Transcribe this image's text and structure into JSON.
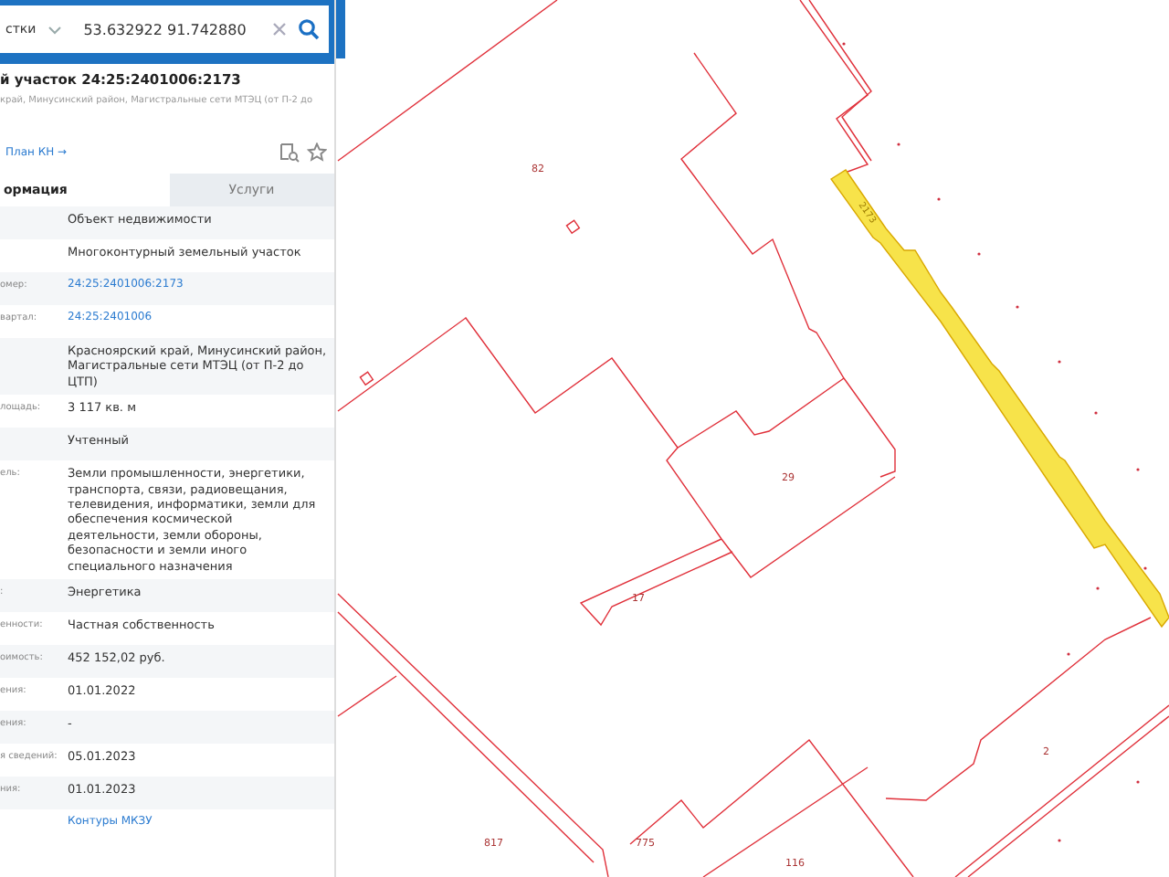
{
  "search": {
    "type_label": "стки",
    "value": "53.632922 91.742880"
  },
  "object": {
    "title": "й участок 24:25:2401006:2173",
    "address": "край, Минусинский район, Магистральные сети МТЭЦ (от П-2 до",
    "plan_link": "План КН →"
  },
  "tabs": [
    {
      "label": "ормация",
      "selected": true
    },
    {
      "label": "Услуги",
      "selected": false
    }
  ],
  "rows": [
    {
      "value": "Объект недвижимости",
      "kind": "text"
    },
    {
      "value": "Многоконтурный земельный участок",
      "kind": "text"
    },
    {
      "label": "омер:",
      "value": "24:25:2401006:2173",
      "kind": "link"
    },
    {
      "label": "вартал:",
      "value": "24:25:2401006",
      "kind": "link"
    },
    {
      "value": "Красноярский край, Минусинский район, Магистральные сети МТЭЦ (от П-2 до ЦТП)",
      "kind": "text"
    },
    {
      "label": "лощадь:",
      "value": "3 117 кв. м",
      "kind": "text"
    },
    {
      "value": "Учтенный",
      "kind": "text"
    },
    {
      "label": "ель:",
      "value": "Земли промышленности, энергетики, транспорта, связи, радиовещания, телевидения, информатики, земли для обеспечения космической деятельности, земли обороны, безопасности и земли иного специального назначения",
      "kind": "text"
    },
    {
      "label": ":",
      "value": "Энергетика",
      "kind": "text"
    },
    {
      "label": "енности:",
      "value": "Частная собственность",
      "kind": "text"
    },
    {
      "label": "оимость:",
      "value": "452 152,02 руб.",
      "kind": "text"
    },
    {
      "label": "ения:",
      "value": "01.01.2022",
      "kind": "text"
    },
    {
      "label": "ения:",
      "value": "-",
      "kind": "text"
    },
    {
      "label": "я сведений:",
      "value": "05.01.2023",
      "kind": "text"
    },
    {
      "label": "ния:",
      "value": "01.01.2023",
      "kind": "text"
    },
    {
      "value": "Контуры МКЗУ",
      "kind": "link"
    }
  ],
  "map": {
    "labels": [
      "82",
      "29",
      "17",
      "817",
      "775",
      "116",
      "2"
    ],
    "highlight_label": "2173"
  }
}
